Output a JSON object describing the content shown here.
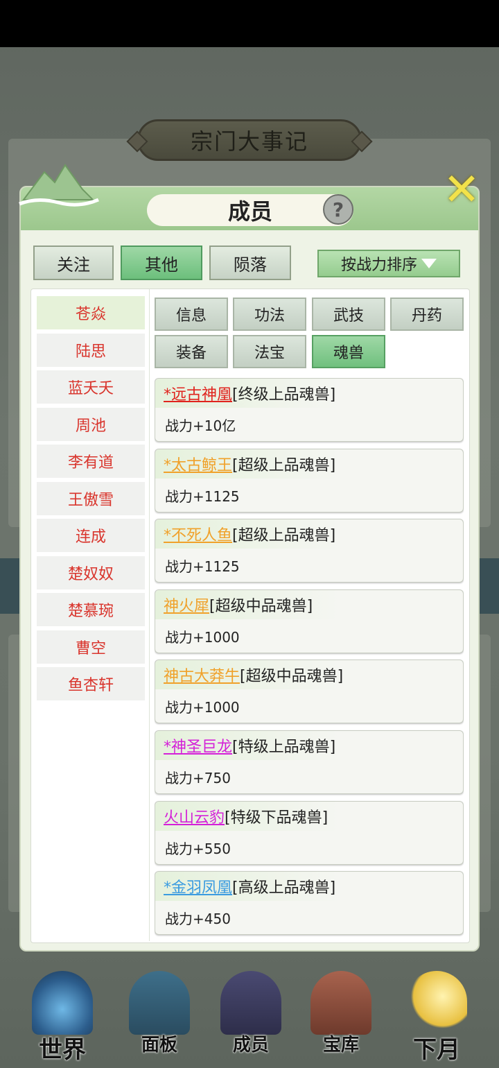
{
  "header": {
    "title": "宗门大事记"
  },
  "panel": {
    "title": "成员",
    "help_symbol": "?",
    "close_symbol": "✕"
  },
  "filters": [
    {
      "label": "关注",
      "active": false
    },
    {
      "label": "其他",
      "active": true
    },
    {
      "label": "陨落",
      "active": false
    }
  ],
  "sort": {
    "label": "按战力排序"
  },
  "members": [
    "苍焱",
    "陆思",
    "蓝夭夭",
    "周池",
    "李有道",
    "王傲雪",
    "连成",
    "楚奴奴",
    "楚慕琬",
    "曹空",
    "鱼杏轩"
  ],
  "categories": [
    "信息",
    "功法",
    "武技",
    "丹药",
    "装备",
    "法宝",
    "魂兽"
  ],
  "active_category": "魂兽",
  "beasts": [
    {
      "name": "*远古神凰",
      "grade": "[终级上品魂兽]",
      "power": "战力+10亿",
      "color": "#e0231d"
    },
    {
      "name": "*太古鲸王",
      "grade": "[超级上品魂兽]",
      "power": "战力+1125",
      "color": "#f0a12a"
    },
    {
      "name": "*不死人鱼",
      "grade": "[超级上品魂兽]",
      "power": "战力+1125",
      "color": "#f0a12a"
    },
    {
      "name": "神火犀",
      "grade": "[超级中品魂兽]",
      "power": "战力+1000",
      "color": "#f0a12a"
    },
    {
      "name": "神古大莽牛",
      "grade": "[超级中品魂兽]",
      "power": "战力+1000",
      "color": "#f0a12a"
    },
    {
      "name": "*神圣巨龙",
      "grade": "[特级上品魂兽]",
      "power": "战力+750",
      "color": "#d420d8"
    },
    {
      "name": "火山云豹",
      "grade": "[特级下品魂兽]",
      "power": "战力+550",
      "color": "#d420d8"
    },
    {
      "name": "*金羽凤凰",
      "grade": "[高级上品魂兽]",
      "power": "战力+450",
      "color": "#3a9be0"
    }
  ],
  "nav": [
    {
      "label": "世界",
      "icon": "world-icon"
    },
    {
      "label": "面板",
      "icon": "panel-icon"
    },
    {
      "label": "成员",
      "icon": "members-icon"
    },
    {
      "label": "宝库",
      "icon": "treasury-icon"
    },
    {
      "label": "下月",
      "icon": "next-month-icon"
    }
  ]
}
